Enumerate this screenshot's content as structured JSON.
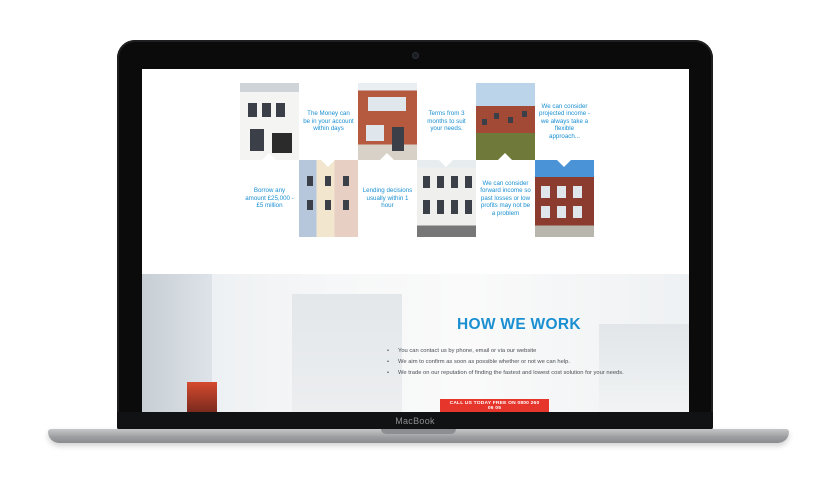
{
  "device": {
    "brand_label": "MacBook"
  },
  "tiles": {
    "t_money": "The Money can be in your account within days",
    "t_terms": "Terms from 3 months to suit your needs.",
    "t_projected": "We can consider projected income - we always take a flexible approach...",
    "t_borrow": "Borrow any amount £25,000 - £5 million",
    "t_lending": "Lending decisions usually within 1 hour",
    "t_forward": "We can consider forward income so past losses or low profits may not be a problem"
  },
  "how_we_work": {
    "title": "HOW WE WORK",
    "bullets": [
      "You can contact us by phone, email or via our website",
      "We aim to confirm as soon as possible whether or not we can help.",
      "We trade on our reputation of finding the fastest and lowest cost solution for your needs."
    ],
    "cta_label": "CALL US TODAY FREE ON 0800 260 06 05",
    "cta_color": "#e6352b",
    "accent_color": "#1a8fd1"
  }
}
